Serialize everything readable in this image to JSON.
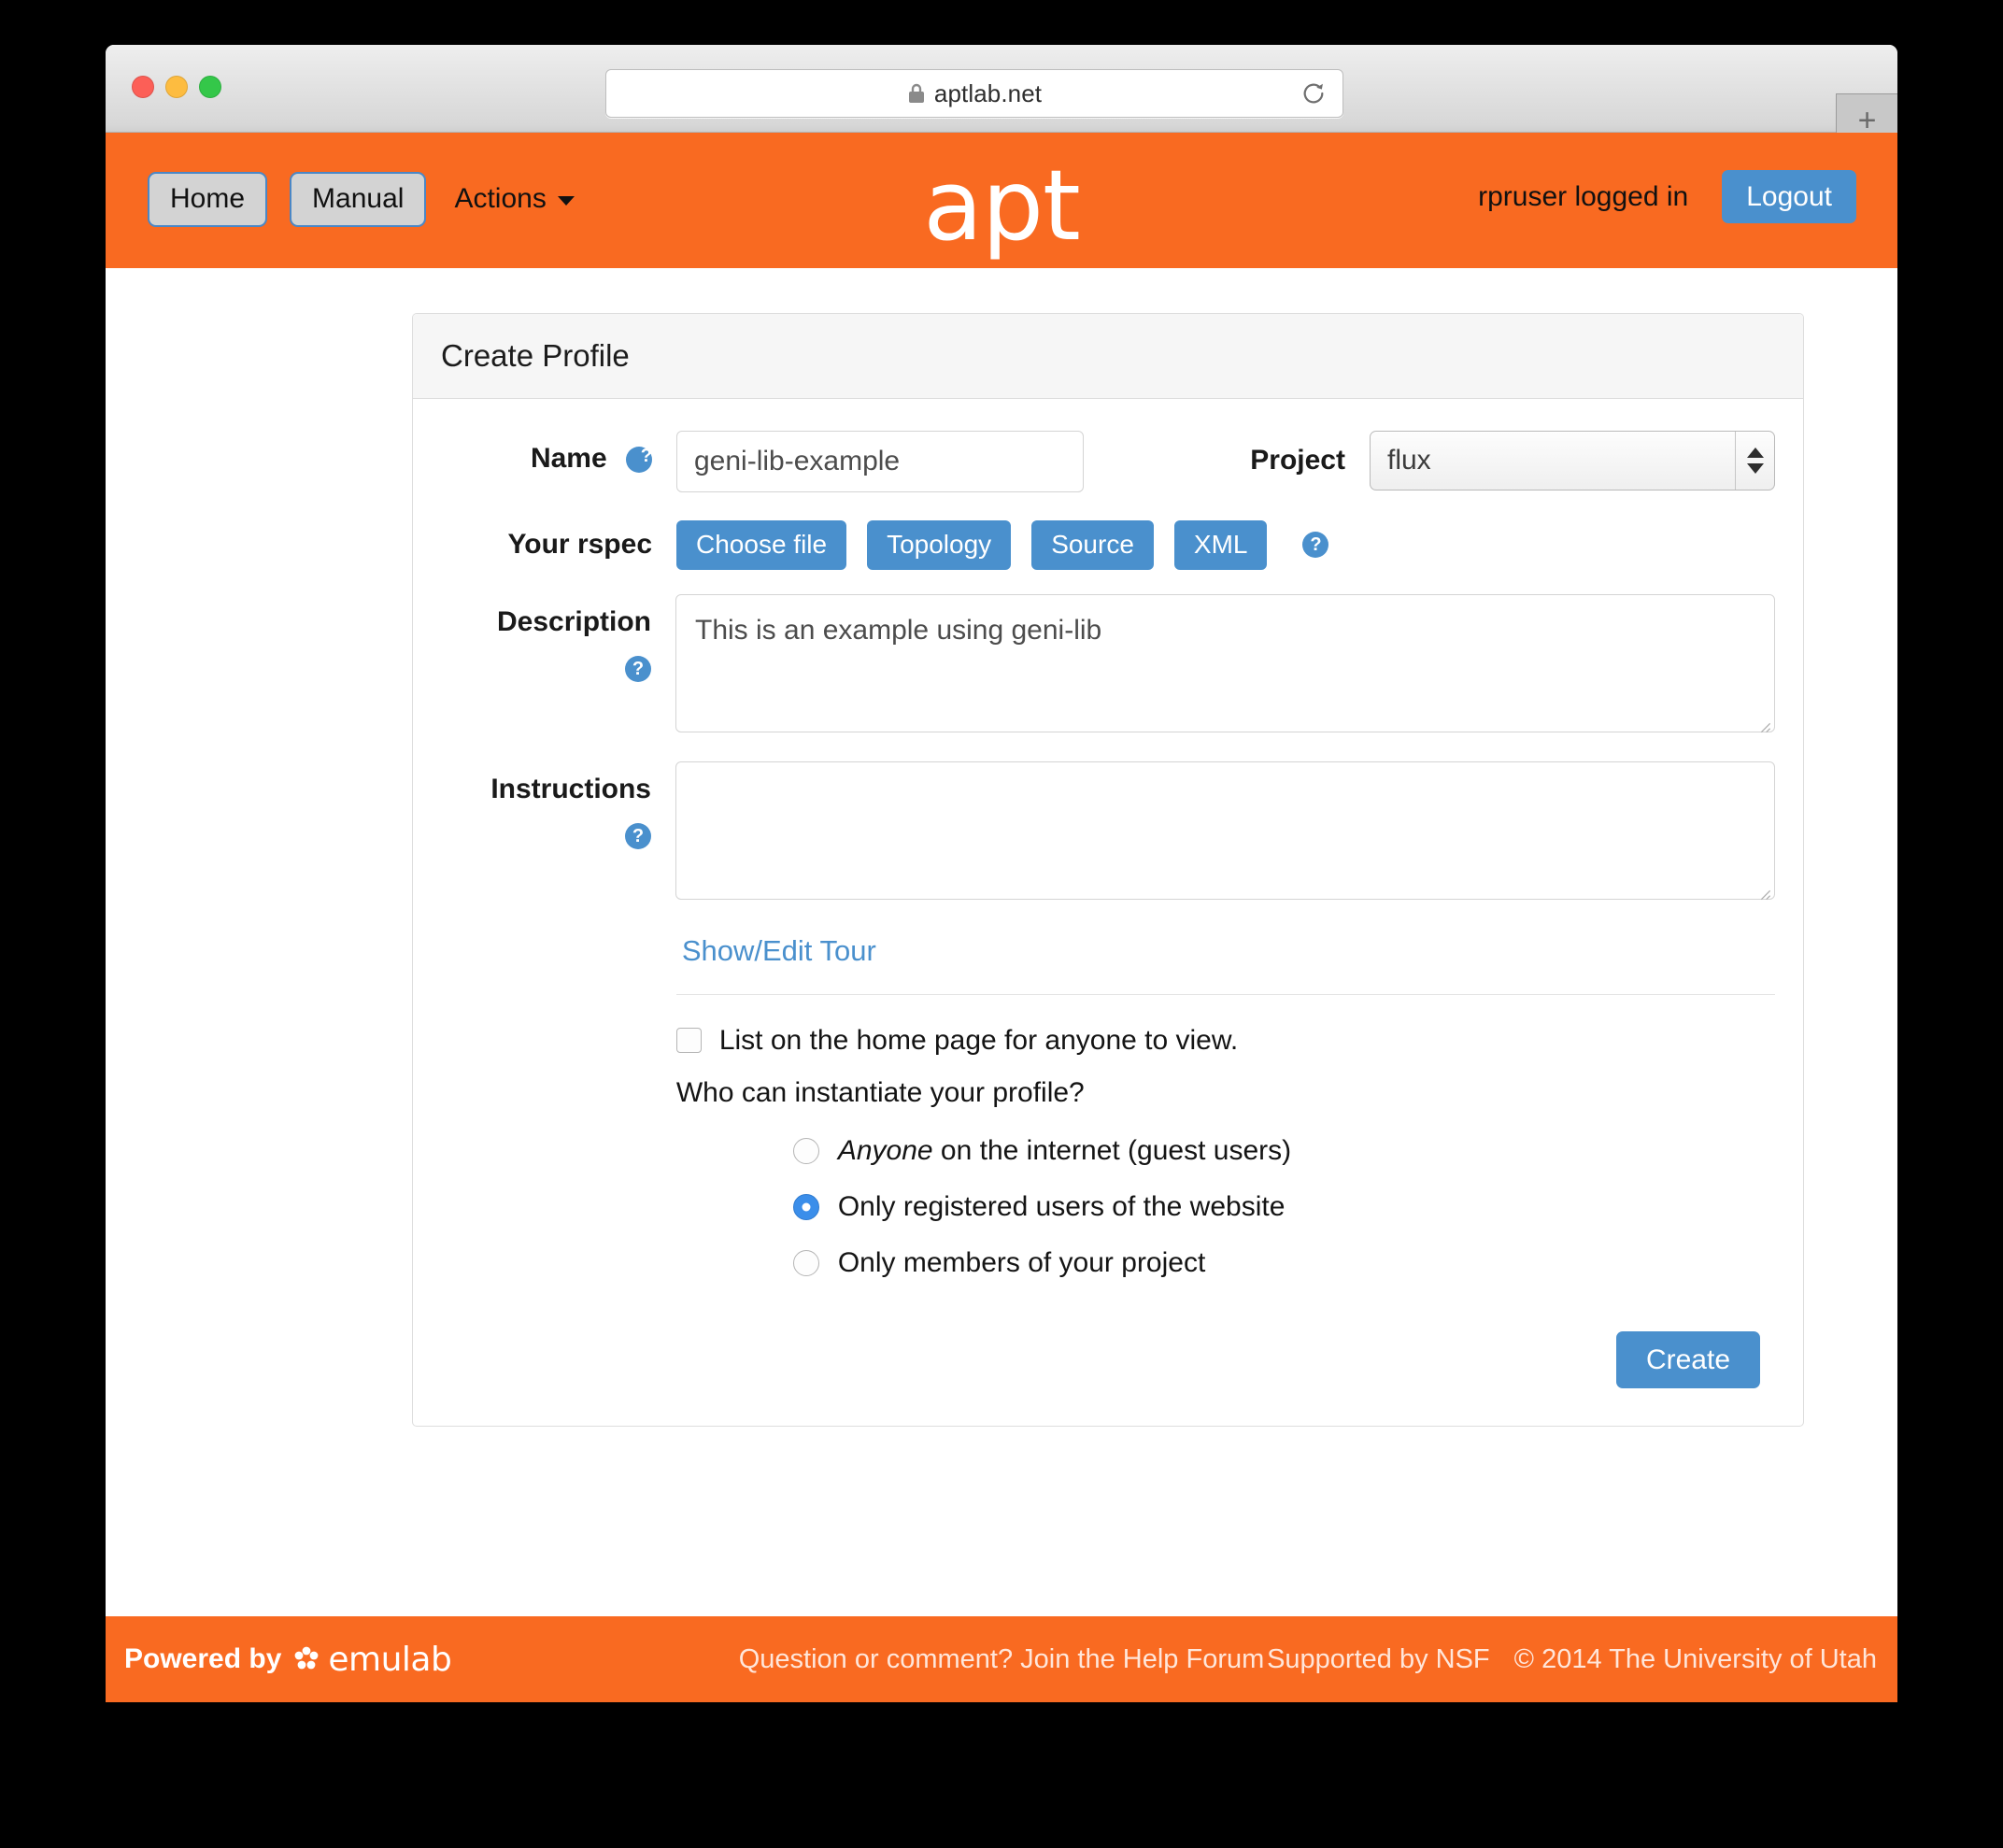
{
  "browser": {
    "url": "aptlab.net",
    "lock_icon": "lock-icon",
    "reload_icon": "reload-icon",
    "new_tab_label": "+"
  },
  "navbar": {
    "home_label": "Home",
    "manual_label": "Manual",
    "actions_label": "Actions",
    "brand": "apt",
    "logged_in_text": "rpruser logged in",
    "logout_label": "Logout",
    "bg_color": "#f96a21"
  },
  "panel": {
    "title": "Create Profile"
  },
  "form": {
    "name": {
      "label": "Name",
      "help": "?",
      "value": "geni-lib-example",
      "placeholder": ""
    },
    "project": {
      "label": "Project",
      "value": "flux",
      "options": [
        "flux"
      ]
    },
    "rspec": {
      "label": "Your rspec",
      "help": "?",
      "buttons": [
        {
          "label": "Choose file",
          "name": "choose-file-button"
        },
        {
          "label": "Topology",
          "name": "topology-button"
        },
        {
          "label": "Source",
          "name": "source-button"
        },
        {
          "label": "XML",
          "name": "xml-button"
        }
      ]
    },
    "description": {
      "label": "Description",
      "help": "?",
      "value": "This is an example using geni-lib",
      "placeholder": ""
    },
    "instructions": {
      "label": "Instructions",
      "help": "?",
      "value": "",
      "placeholder": ""
    },
    "tour_link": "Show/Edit Tour",
    "list_checkbox": {
      "label": "List on the home page for anyone to view.",
      "checked": false
    },
    "who_question": "Who can instantiate your profile?",
    "radios": [
      {
        "label_em": "Anyone",
        "label_rest": " on the internet (guest users)",
        "checked": false
      },
      {
        "label_em": "",
        "label_rest": "Only registered users of the website",
        "checked": true
      },
      {
        "label_em": "",
        "label_rest": "Only members of your project",
        "checked": false
      }
    ],
    "create_label": "Create"
  },
  "footer": {
    "powered_by": "Powered by",
    "emulab": "emulab",
    "help_forum": "Question or comment? Join the Help Forum",
    "nsf": "Supported by NSF",
    "copyright": "© 2014 The University of Utah"
  },
  "colors": {
    "brand_orange": "#f96a21",
    "accent_blue": "#4a90cd",
    "radio_blue": "#3b8eea"
  }
}
